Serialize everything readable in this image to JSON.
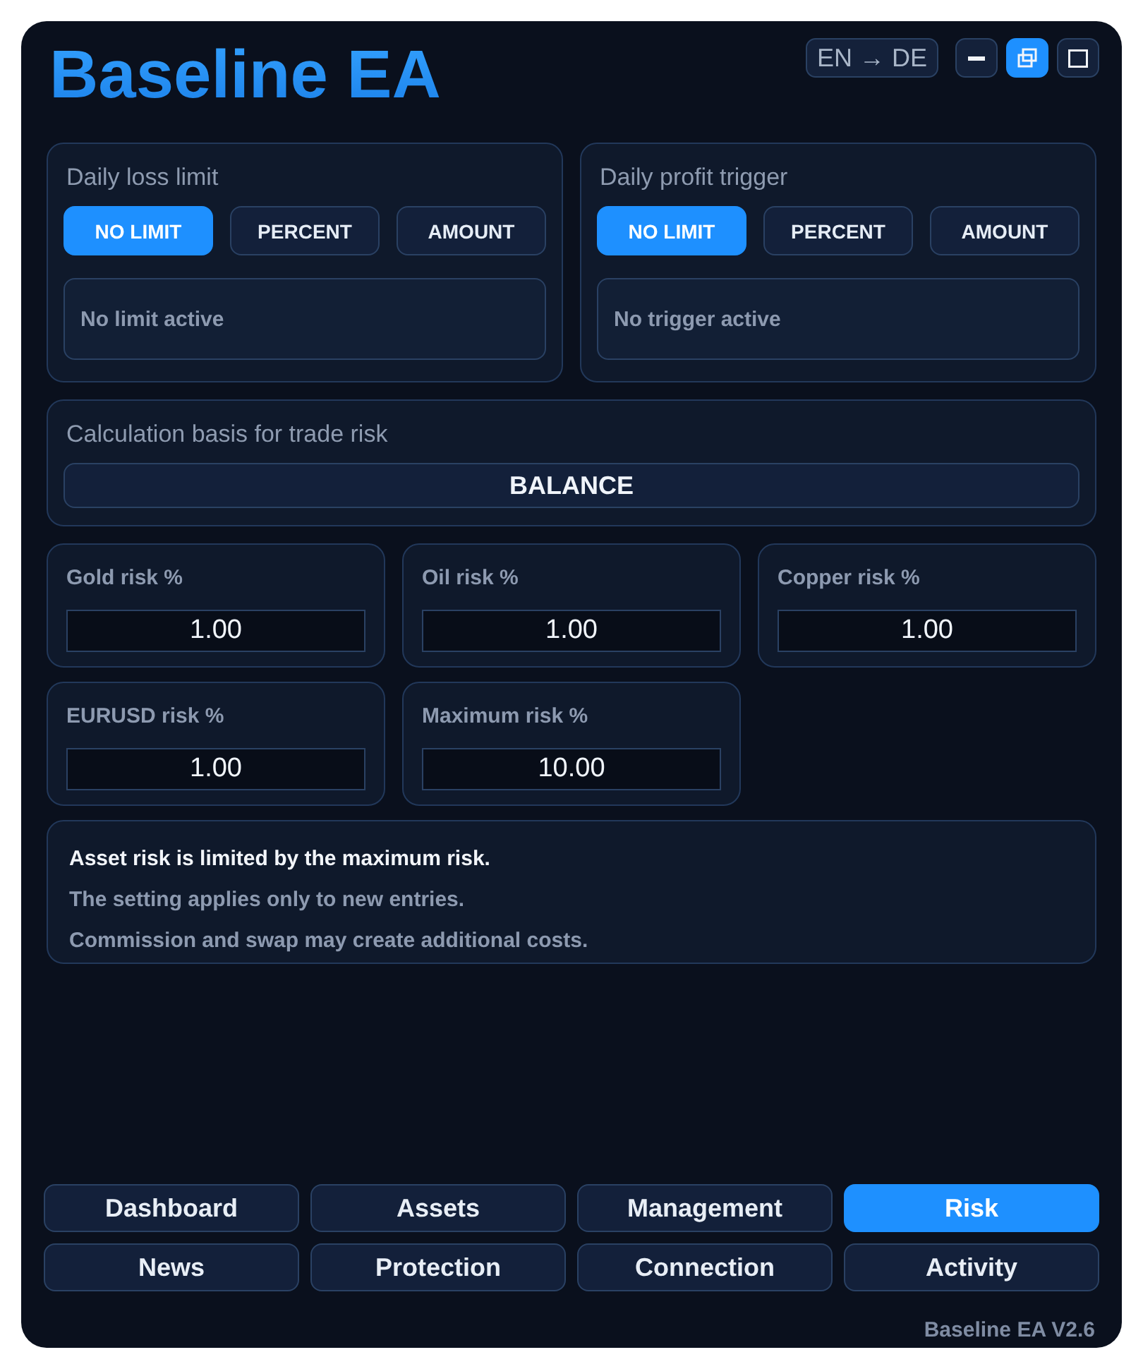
{
  "header": {
    "title": "Baseline EA",
    "language_button": "EN → DE",
    "window_controls": [
      {
        "kind": "minimize",
        "selected": false
      },
      {
        "kind": "restore",
        "selected": true
      },
      {
        "kind": "maximize",
        "selected": false
      }
    ]
  },
  "limit_cards": [
    {
      "title": "Daily loss limit",
      "options": [
        {
          "label": "NO LIMIT",
          "selected": true
        },
        {
          "label": "PERCENT",
          "selected": false
        },
        {
          "label": "AMOUNT",
          "selected": false
        }
      ],
      "status": "No limit active"
    },
    {
      "title": "Daily profit trigger",
      "options": [
        {
          "label": "NO LIMIT",
          "selected": true
        },
        {
          "label": "PERCENT",
          "selected": false
        },
        {
          "label": "AMOUNT",
          "selected": false
        }
      ],
      "status": "No trigger active"
    }
  ],
  "calculation_basis": {
    "title": "Calculation basis for trade risk",
    "value": "BALANCE"
  },
  "risk_fields": [
    {
      "label": "Gold risk %",
      "value": "1.00"
    },
    {
      "label": "Oil risk %",
      "value": "1.00"
    },
    {
      "label": "Copper risk %",
      "value": "1.00"
    },
    {
      "label": "EURUSD risk %",
      "value": "1.00"
    },
    {
      "label": "Maximum risk %",
      "value": "10.00"
    }
  ],
  "info": {
    "lines": [
      {
        "text": "Asset risk is limited by the maximum risk.",
        "kind": "emphasis"
      },
      {
        "text": "The setting applies only to new entries.",
        "kind": "note"
      },
      {
        "text": "Commission and swap may create additional costs.",
        "kind": "note"
      }
    ]
  },
  "nav_tabs": [
    {
      "label": "Dashboard",
      "selected": false
    },
    {
      "label": "Assets",
      "selected": false
    },
    {
      "label": "Management",
      "selected": false
    },
    {
      "label": "Risk",
      "selected": true
    },
    {
      "label": "News",
      "selected": false
    },
    {
      "label": "Protection",
      "selected": false
    },
    {
      "label": "Connection",
      "selected": false
    },
    {
      "label": "Activity",
      "selected": false
    }
  ],
  "footer": {
    "version": "Baseline EA V2.6"
  }
}
